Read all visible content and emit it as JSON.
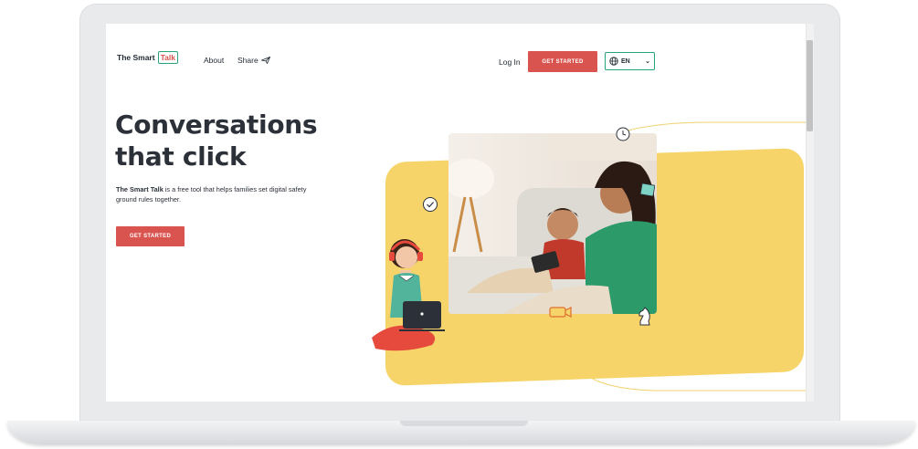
{
  "header": {
    "logo_prefix": "The Smart",
    "logo_highlight": "Talk",
    "nav": [
      "About",
      "Share"
    ],
    "login": "Log In",
    "cta": "GET STARTED",
    "language": "EN"
  },
  "hero": {
    "headline_line1": "Conversations",
    "headline_line2": "that click",
    "desc_bold": "The Smart Talk",
    "desc_rest": " is a free tool that helps families set digital safety ground rules together.",
    "cta": "GET STARTED"
  },
  "icons": {
    "share": "paper-plane-icon",
    "language": "globe-icon",
    "dropdown": "chevron-down-icon"
  },
  "colors": {
    "accent_red": "#d9534f",
    "accent_green": "#29a37a",
    "illustration_yellow": "#f7d46a",
    "text_dark": "#2b3039"
  }
}
